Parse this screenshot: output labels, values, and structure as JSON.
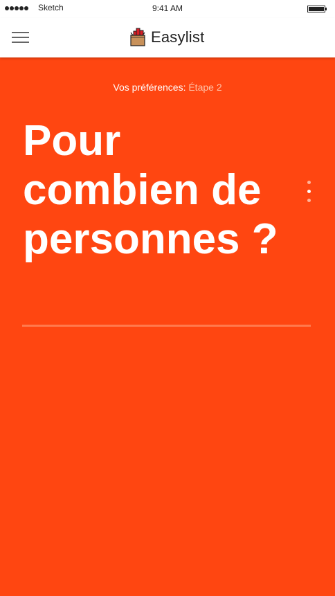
{
  "status_bar": {
    "carrier": "Sketch",
    "time": "9:41 AM"
  },
  "nav": {
    "brand_name": "Easylist",
    "logo_icon": "basket-icon",
    "menu_icon": "hamburger-menu-icon"
  },
  "main": {
    "step_label": "Vos préférences:",
    "step_value": "Étape 2",
    "question_lines": [
      "Pour",
      "combien de",
      "personnes ?"
    ],
    "pager_icon": "vertical-dots-pager-icon",
    "pager": {
      "total": 3,
      "active": 2
    }
  },
  "colors": {
    "accent": "#ff4611",
    "step_value": "#ffc2a8",
    "answer_line": "#ff7a4e"
  }
}
